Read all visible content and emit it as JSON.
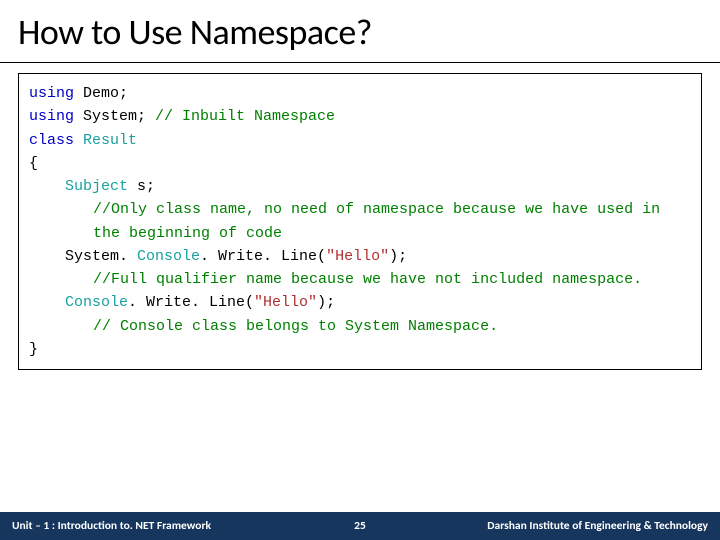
{
  "title": "How to Use Namespace?",
  "code": {
    "l1_kw": "using",
    "l1_rest": " Demo;",
    "l2_kw": "using",
    "l2_rest": " System; ",
    "l2_cm": "// Inbuilt Namespace",
    "l3_kw": "class",
    "l3_sp": " ",
    "l3_typ": "Result",
    "l4": "{",
    "l5_typ": "Subject",
    "l5_rest": " s;",
    "l6_cm": "//Only class name, no need of namespace because we have used in the beginning of code",
    "l7_a": "System. ",
    "l7_typ": "Console",
    "l7_b": ". Write. Line(",
    "l7_str": "\"Hello\"",
    "l7_c": ");",
    "l8_cm": "//Full qualifier name because we have not included namespace.",
    "l9_typ": "Console",
    "l9_a": ". Write. Line(",
    "l9_str": "\"Hello\"",
    "l9_b": ");",
    "l10_cm": "// Console class belongs to System Namespace.",
    "l11": "}"
  },
  "footer": {
    "left": "Unit – 1 : Introduction to. NET Framework",
    "center": "25",
    "right": "Darshan Institute of Engineering & Technology"
  }
}
